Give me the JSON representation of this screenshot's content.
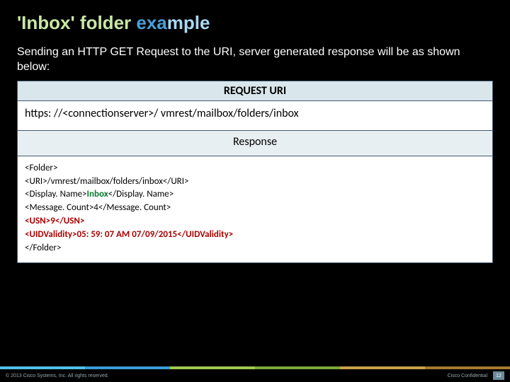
{
  "title": {
    "quoted": "'Inbox' folder ",
    "exa": "exa",
    "mple": "mple"
  },
  "subtitle": "Sending an HTTP GET Request to the URI, server generated response will be as shown below:",
  "table": {
    "request_header": "REQUEST URI",
    "request_uri": "https: //<connectionserver>/ vmrest/mailbox/folders/inbox",
    "response_header": "Response",
    "response_lines": {
      "l0": "<Folder>",
      "l1": "<URI>/vmrest/mailbox/folders/inbox</URI>",
      "l2a": "<Display. Name>",
      "l2b": "Inbox",
      "l2c": "</Display. Name>",
      "l3": "<Message. Count>4</Message. Count>",
      "l4": "<USN>9</USN>",
      "l5": "<UIDValidity>05: 59: 07 AM 07/09/2015</UIDValidity>",
      "l6": "</Folder>"
    }
  },
  "footer": {
    "copyright": "© 2013 Cisco Systems, Inc. All rights reserved.",
    "confidential": "Cisco Confidential",
    "page": "12"
  }
}
